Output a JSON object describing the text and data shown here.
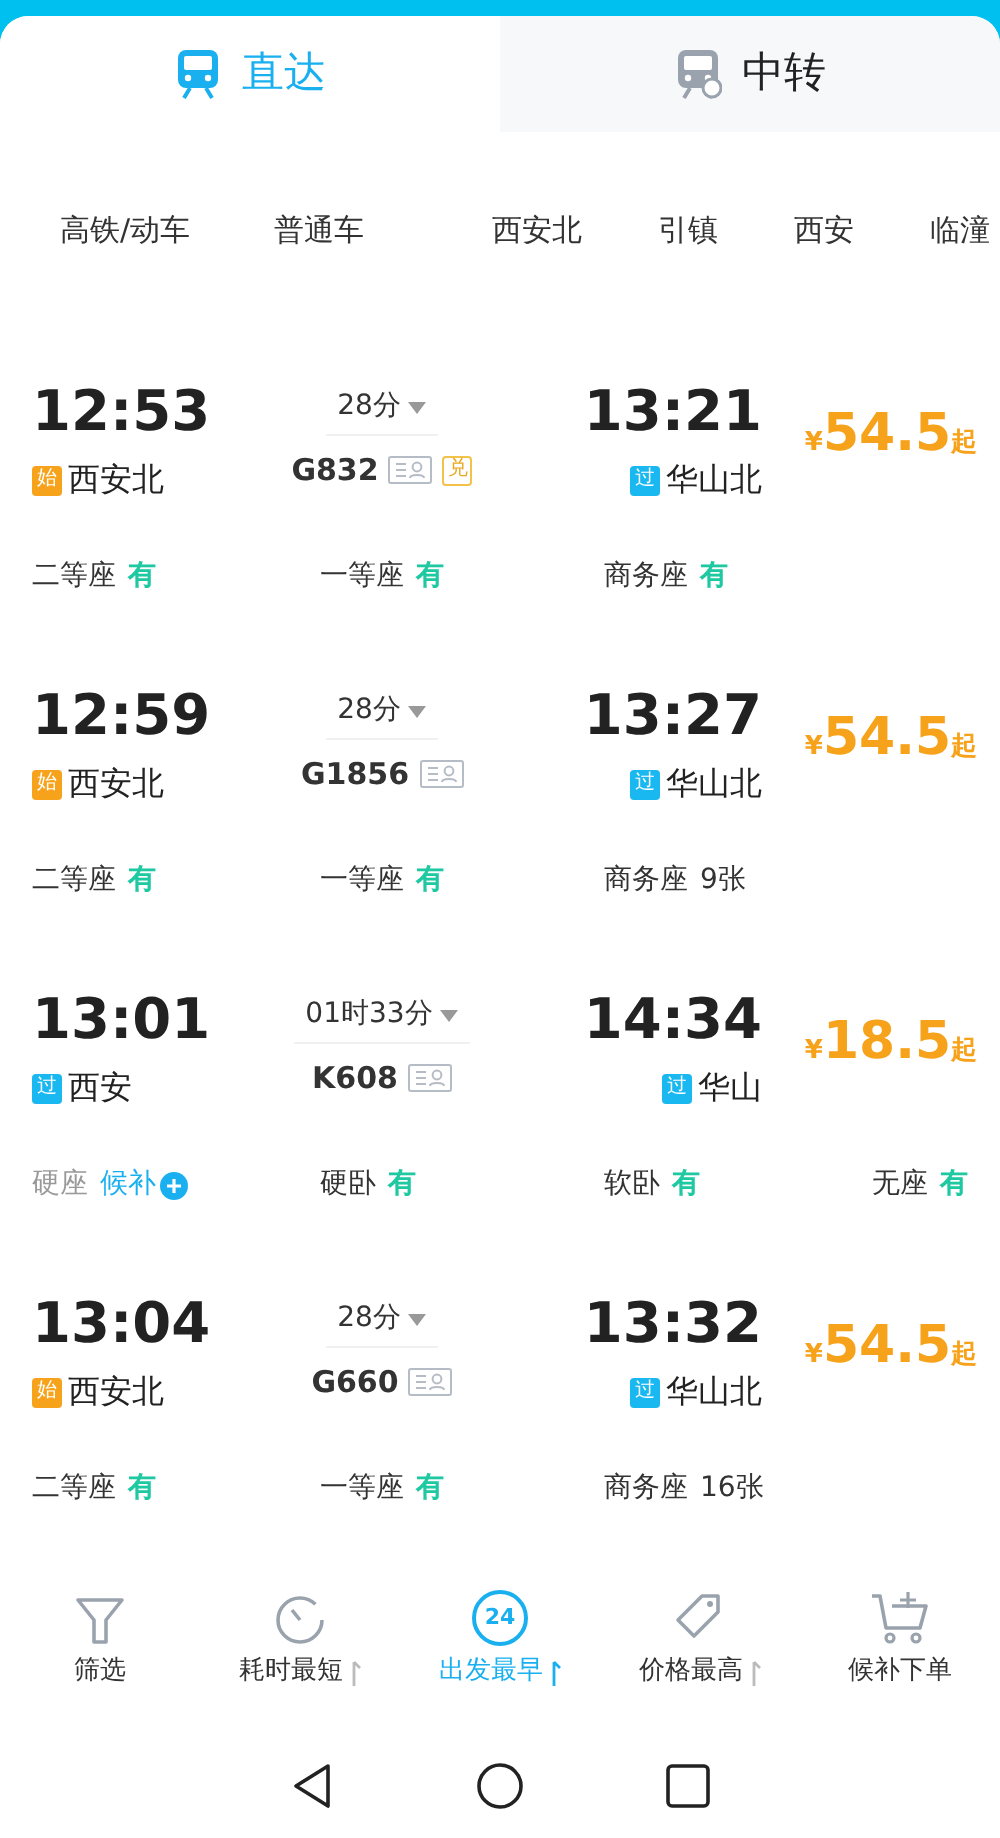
{
  "tabs": [
    {
      "label": "直达",
      "kind": "direct",
      "selected": true
    },
    {
      "label": "中转",
      "kind": "transfer",
      "selected": false
    }
  ],
  "filters": {
    "types": [
      "高铁/动车",
      "普通车"
    ],
    "stations": [
      "西安北",
      "引镇",
      "西安",
      "临潼"
    ]
  },
  "trains": [
    {
      "dep_time": "12:53",
      "dep_tag": {
        "kind": "start",
        "label": "始"
      },
      "dep_station": "西安北",
      "duration": "28分",
      "train_no": "G832",
      "badges": [
        {
          "kind": "seat"
        },
        {
          "kind": "exchange",
          "label": "兑"
        }
      ],
      "arr_time": "13:21",
      "arr_tag": {
        "kind": "pass",
        "label": "过"
      },
      "arr_station": "华山北",
      "currency": "¥",
      "price": "54.5",
      "price_suffix": "起",
      "seats": [
        {
          "name": "二等座",
          "availability": "有",
          "kind": "available"
        },
        {
          "name": "一等座",
          "availability": "有",
          "kind": "available"
        },
        {
          "name": "商务座",
          "availability": "有",
          "kind": "available"
        }
      ]
    },
    {
      "dep_time": "12:59",
      "dep_tag": {
        "kind": "start",
        "label": "始"
      },
      "dep_station": "西安北",
      "duration": "28分",
      "train_no": "G1856",
      "badges": [
        {
          "kind": "seat"
        }
      ],
      "arr_time": "13:27",
      "arr_tag": {
        "kind": "pass",
        "label": "过"
      },
      "arr_station": "华山北",
      "currency": "¥",
      "price": "54.5",
      "price_suffix": "起",
      "seats": [
        {
          "name": "二等座",
          "availability": "有",
          "kind": "available"
        },
        {
          "name": "一等座",
          "availability": "有",
          "kind": "available"
        },
        {
          "name": "商务座",
          "availability": "9张",
          "kind": "count"
        }
      ]
    },
    {
      "dep_time": "13:01",
      "dep_tag": {
        "kind": "pass",
        "label": "过"
      },
      "dep_station": "西安",
      "duration": "01时33分",
      "train_no": "K608",
      "badges": [
        {
          "kind": "seat"
        }
      ],
      "arr_time": "14:34",
      "arr_tag": {
        "kind": "pass",
        "label": "过"
      },
      "arr_station": "华山",
      "currency": "¥",
      "price": "18.5",
      "price_suffix": "起",
      "seats": [
        {
          "name": "硬座",
          "availability": "候补",
          "kind": "waitlist"
        },
        {
          "name": "硬卧",
          "availability": "有",
          "kind": "available"
        },
        {
          "name": "软卧",
          "availability": "有",
          "kind": "available"
        },
        {
          "name": "无座",
          "availability": "有",
          "kind": "available"
        }
      ]
    },
    {
      "dep_time": "13:04",
      "dep_tag": {
        "kind": "start",
        "label": "始"
      },
      "dep_station": "西安北",
      "duration": "28分",
      "train_no": "G660",
      "badges": [
        {
          "kind": "seat"
        }
      ],
      "arr_time": "13:32",
      "arr_tag": {
        "kind": "pass",
        "label": "过"
      },
      "arr_station": "华山北",
      "currency": "¥",
      "price": "54.5",
      "price_suffix": "起",
      "seats": [
        {
          "name": "二等座",
          "availability": "有",
          "kind": "available"
        },
        {
          "name": "一等座",
          "availability": "有",
          "kind": "available"
        },
        {
          "name": "商务座",
          "availability": "16张",
          "kind": "count"
        }
      ]
    }
  ],
  "actions": [
    {
      "label": "筛选",
      "kind": "filter",
      "selected": false,
      "sortable": false
    },
    {
      "label": "耗时最短",
      "kind": "timer",
      "selected": false,
      "sortable": true
    },
    {
      "label": "出发最早",
      "kind": "clock24",
      "icon_text": "24",
      "selected": true,
      "sortable": true
    },
    {
      "label": "价格最高",
      "kind": "tag",
      "selected": false,
      "sortable": true
    },
    {
      "label": "候补下单",
      "kind": "cart",
      "selected": false,
      "sortable": false
    }
  ]
}
